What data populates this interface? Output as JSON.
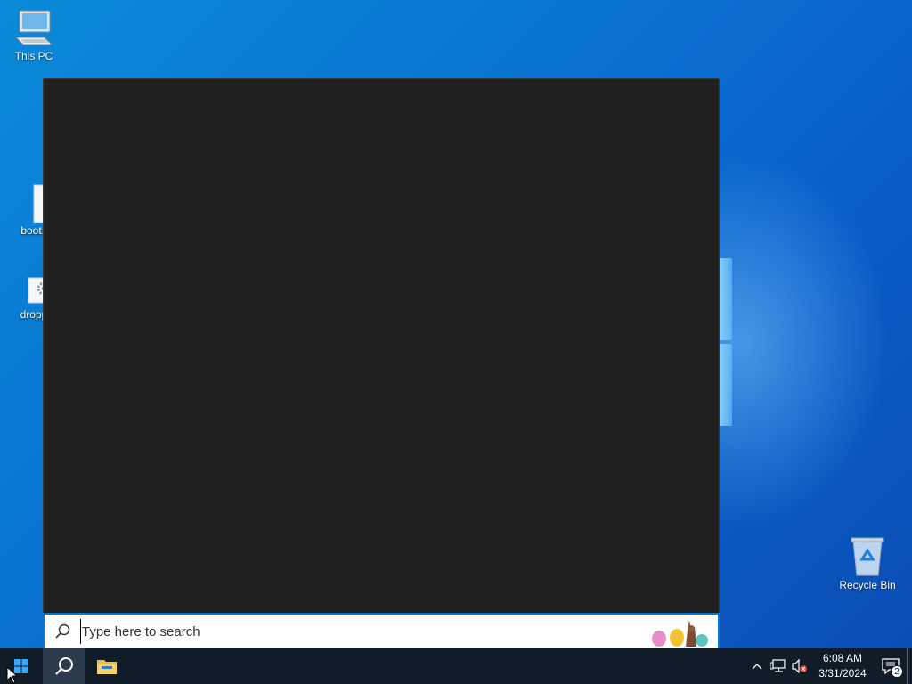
{
  "desktop": {
    "icons": [
      {
        "label": "This PC"
      },
      {
        "label": "boot.i"
      },
      {
        "label": "dropp"
      },
      {
        "label": "Recycle Bin"
      }
    ]
  },
  "search": {
    "placeholder": "Type here to search"
  },
  "taskbar": {
    "start_icon": "windows-logo-icon",
    "search_icon": "search-icon",
    "explorer_icon": "file-explorer-icon"
  },
  "tray": {
    "time": "6:08 AM",
    "date": "3/31/2024",
    "notification_count": "2"
  },
  "colors": {
    "accent": "#0078d7",
    "taskbar": "#101c28",
    "panel": "#202020"
  }
}
